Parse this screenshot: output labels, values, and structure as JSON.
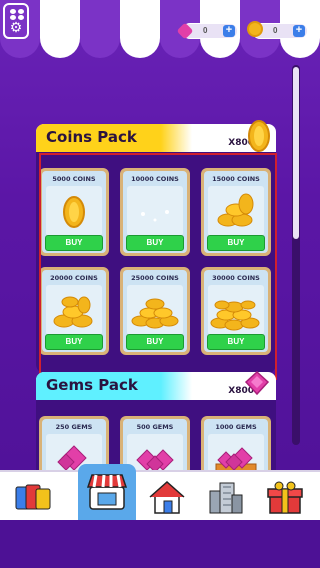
{
  "currencies": {
    "gems": {
      "value": "0",
      "icon": "gem-icon",
      "color": "#e23fa8"
    },
    "coins": {
      "value": "0",
      "icon": "coin-icon",
      "color": "#f3b51c"
    }
  },
  "coins_pack": {
    "title": "Coins Pack",
    "multiplier": "X800",
    "band_color": "#ffd21a",
    "items": [
      {
        "label": "5000 COINS",
        "buy": "BUY"
      },
      {
        "label": "10000 COINS",
        "buy": "BUY"
      },
      {
        "label": "15000 COINS",
        "buy": "BUY"
      },
      {
        "label": "20000 COINS",
        "buy": "BUY"
      },
      {
        "label": "25000 COINS",
        "buy": "BUY"
      },
      {
        "label": "30000 COINS",
        "buy": "BUY"
      }
    ]
  },
  "gems_pack": {
    "title": "Gems Pack",
    "multiplier": "X800",
    "band_color": "#5ff0ff",
    "items": [
      {
        "label": "250 GEMS"
      },
      {
        "label": "500 GEMS"
      },
      {
        "label": "1000 GEMS"
      }
    ]
  },
  "nav": {
    "tabs": [
      {
        "icon": "collection-icon"
      },
      {
        "icon": "shop-icon",
        "active": true
      },
      {
        "icon": "home-icon"
      },
      {
        "icon": "city-icon"
      },
      {
        "icon": "gift-icon"
      }
    ]
  }
}
